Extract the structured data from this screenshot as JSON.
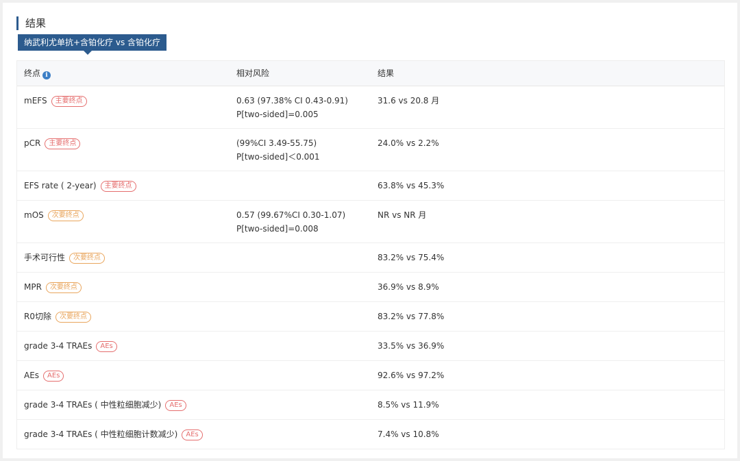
{
  "section": {
    "title": "结果"
  },
  "arm_tab": {
    "label": "纳武利尤单抗+含铂化疗 vs 含铂化疗"
  },
  "table": {
    "headers": {
      "endpoint": "终点",
      "info_icon": "i",
      "risk": "相对风险",
      "result": "结果"
    },
    "rows": [
      {
        "endpoint": "mEFS",
        "tag": "主要终点",
        "risk1": "0.63 (97.38% CI 0.43-0.91)",
        "risk2": "P[two-sided]=0.005",
        "result": "31.6 vs 20.8 月"
      },
      {
        "endpoint": "pCR",
        "tag": "主要终点",
        "risk1": "(99%CI 3.49-55.75)",
        "risk2": "P[two-sided]＜0.001",
        "result": "24.0% vs 2.2%"
      },
      {
        "endpoint": "EFS rate ( 2-year)",
        "tag": "主要终点",
        "risk1": "",
        "risk2": "",
        "result": "63.8% vs 45.3%"
      },
      {
        "endpoint": "mOS",
        "tag": "次要终点",
        "risk1": "0.57 (99.67%CI 0.30-1.07)",
        "risk2": "P[two-sided]=0.008",
        "result": "NR vs NR 月"
      },
      {
        "endpoint": "手术可行性",
        "tag": "次要终点",
        "risk1": "",
        "risk2": "",
        "result": "83.2% vs 75.4%"
      },
      {
        "endpoint": "MPR",
        "tag": "次要终点",
        "risk1": "",
        "risk2": "",
        "result": "36.9% vs 8.9%"
      },
      {
        "endpoint": "R0切除",
        "tag": "次要终点",
        "risk1": "",
        "risk2": "",
        "result": "83.2% vs 77.8%"
      },
      {
        "endpoint": "grade 3-4 TRAEs",
        "tag": "AEs",
        "risk1": "",
        "risk2": "",
        "result": "33.5% vs 36.9%"
      },
      {
        "endpoint": "AEs",
        "tag": "AEs",
        "risk1": "",
        "risk2": "",
        "result": "92.6% vs 97.2%"
      },
      {
        "endpoint": "grade 3-4 TRAEs ( 中性粒细胞减少)",
        "tag": "AEs",
        "risk1": "",
        "risk2": "",
        "result": "8.5% vs 11.9%"
      },
      {
        "endpoint": "grade 3-4 TRAEs ( 中性粒细胞计数减少)",
        "tag": "AEs",
        "risk1": "",
        "risk2": "",
        "result": "7.4% vs 10.8%"
      }
    ]
  },
  "colors": {
    "accent": "#2c5b8e",
    "primary_tag": "#e56d6d",
    "secondary_tag": "#e9a55c",
    "info_icon": "#3d7fc6"
  }
}
